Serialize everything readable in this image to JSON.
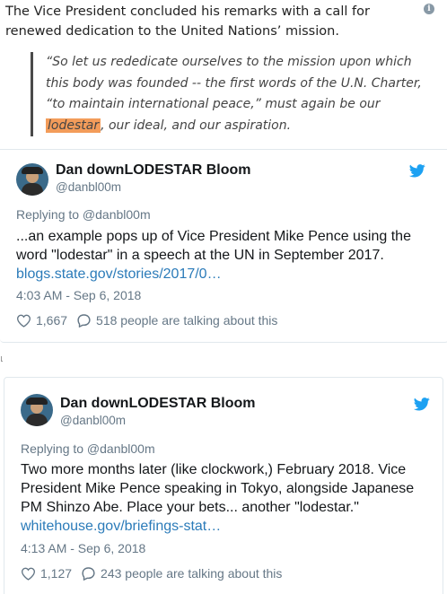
{
  "article": {
    "intro": "The Vice President concluded his remarks with a call for renewed dedication to the United Nations’ mission.",
    "quote_before": "“So let us rededicate ourselves to the mission upon which this body was founded -- the first words of the U.N. Charter, “to maintain international peace,” must again be our ",
    "quote_highlight": "lodestar",
    "quote_after": ", our ideal, and our aspiration.",
    "highlight_color": "#f39c5a"
  },
  "tweets": [
    {
      "name": "Dan downLODESTAR Bloom",
      "handle": "@danbl00m",
      "replying": "Replying to @danbl00m",
      "text": "...an example pops up of Vice President Mike Pence using the word \"lodestar\" in a speech at the UN in September 2017.",
      "link": "blogs.state.gov/stories/2017/0…",
      "time": "4:03 AM - Sep 6, 2018",
      "likes": "1,667",
      "talking": "518 people are talking about this"
    },
    {
      "name": "Dan downLODESTAR Bloom",
      "handle": "@danbl00m",
      "replying": "Replying to @danbl00m",
      "text": "Two more months later (like clockwork,) February 2018. Vice President Mike Pence speaking in Tokyo, alongside Japanese PM Shinzo Abe. Place your bets... another \"lodestar.\"",
      "link": "whitehouse.gov/briefings-stat…",
      "time": "4:13 AM - Sep 6, 2018",
      "likes": "1,127",
      "talking": "243 people are talking about this"
    }
  ],
  "colors": {
    "twitter_blue": "#1da1f2",
    "link": "#2b7bb9",
    "muted": "#657786"
  },
  "icons": [
    "info-icon",
    "twitter-bird-icon",
    "heart-icon",
    "comment-icon"
  ]
}
